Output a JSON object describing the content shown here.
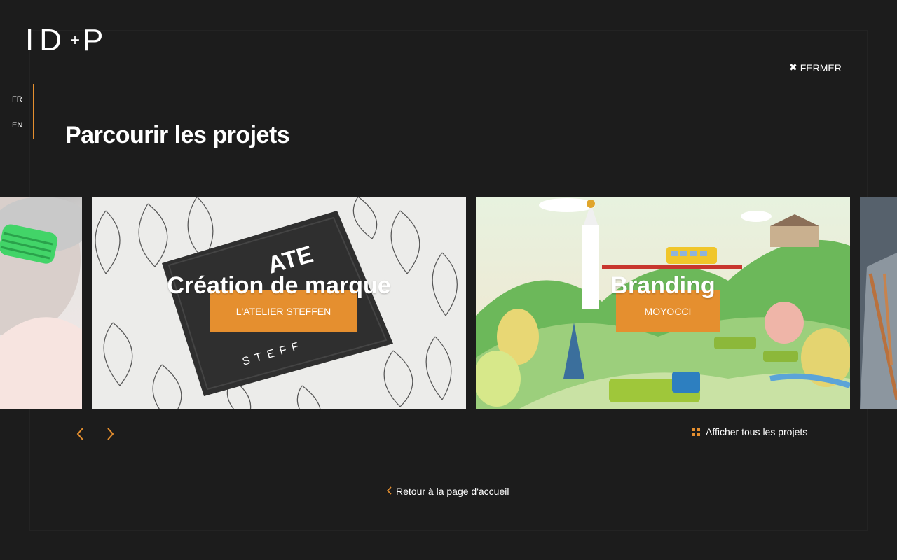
{
  "logo": {
    "part1": "ID",
    "plus": "+",
    "part2": "P"
  },
  "close": {
    "icon": "close-icon",
    "label": "FERMER"
  },
  "languages": [
    "FR",
    "EN"
  ],
  "title": "Parcourir les projets",
  "cards": [
    {
      "category": "",
      "client": ""
    },
    {
      "category": "Création de marque",
      "client": "L'ATELIER STEFFEN"
    },
    {
      "category": "Branding",
      "client": "MOYOCCI"
    },
    {
      "category": "",
      "client": ""
    }
  ],
  "nav": {
    "prev_icon": "chevron-left-icon",
    "next_icon": "chevron-right-icon"
  },
  "show_all": {
    "icon": "grid-icon",
    "label": "Afficher tous les projets"
  },
  "back": {
    "icon": "chevron-left-icon",
    "label": "Retour à la page d'accueil"
  },
  "colors": {
    "accent": "#e58f2f",
    "background": "#1c1c1c"
  }
}
